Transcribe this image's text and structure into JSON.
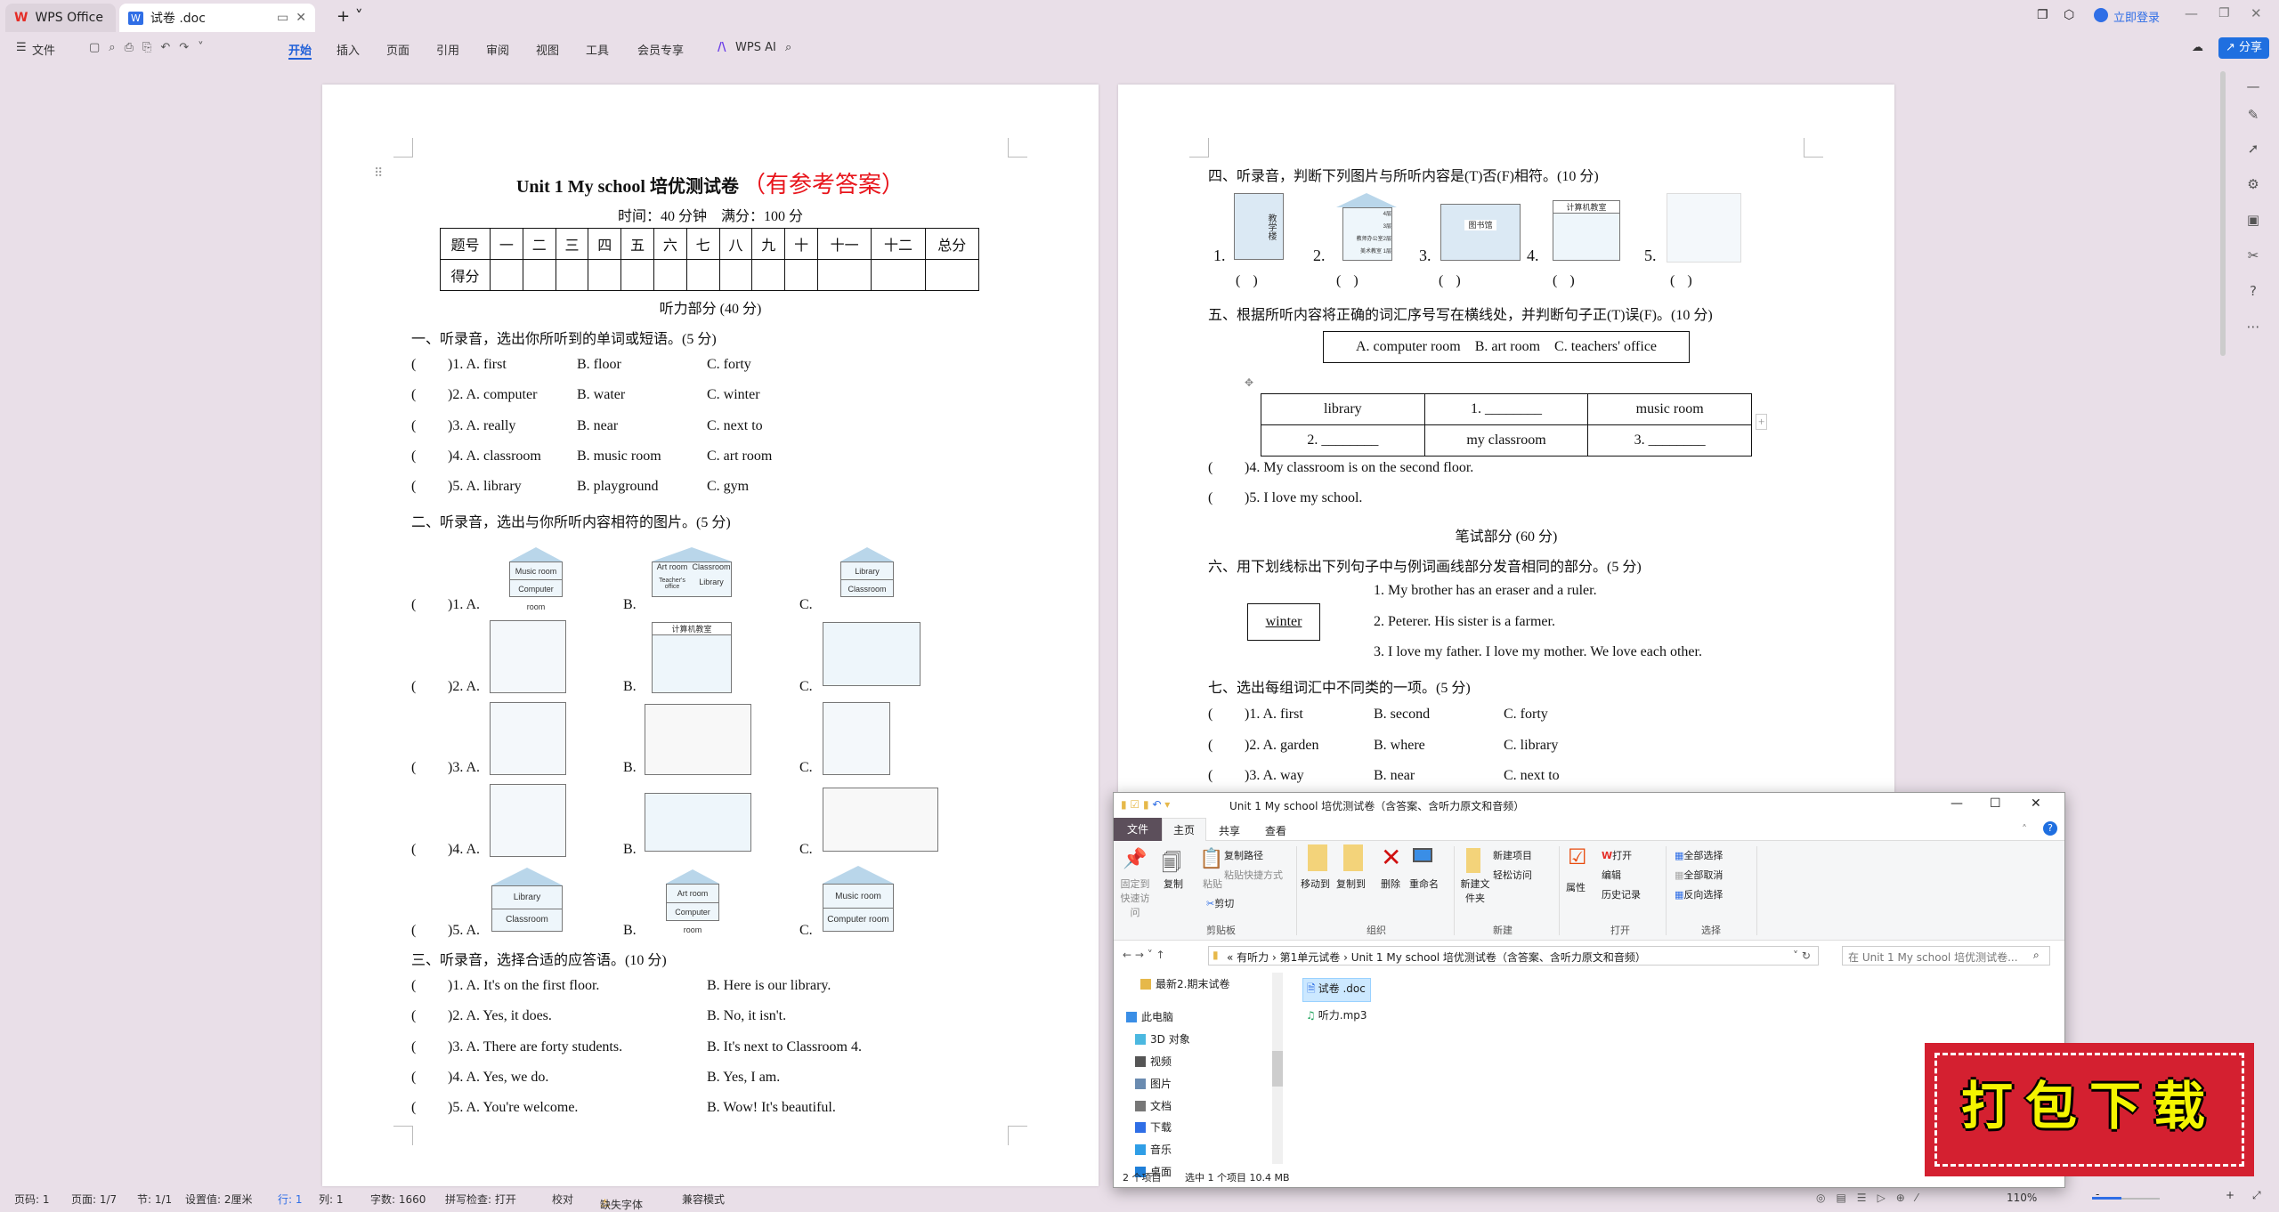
{
  "app": {
    "tabs": [
      {
        "label": "WPS Office",
        "icon": "wps-logo-icon"
      },
      {
        "label": "试卷 .doc",
        "icon": "word-doc-icon"
      }
    ],
    "login": "立即登录",
    "share": "分享",
    "toolbar": {
      "file": "文件",
      "menus": [
        "开始",
        "插入",
        "页面",
        "引用",
        "审阅",
        "视图",
        "工具",
        "会员专享"
      ],
      "active": "开始",
      "ai": "WPS AI"
    }
  },
  "doc_left": {
    "title": "Unit 1 My school 培优测试卷",
    "title_note": "（有参考答案）",
    "title_note_color": "#e8141b",
    "time": "时间：40 分钟　满分：100 分",
    "score_table": {
      "row1": [
        "题号",
        "一",
        "二",
        "三",
        "四",
        "五",
        "六",
        "七",
        "八",
        "九",
        "十",
        "十一",
        "十二",
        "总分"
      ],
      "row2_label": "得分"
    },
    "listening": "听力部分 (40 分)",
    "s1": {
      "heading": "一、听录音，选出你所听到的单词或短语。(5 分)",
      "items": [
        {
          "n": ")1. A. first",
          "b": "B. floor",
          "c": "C. forty"
        },
        {
          "n": ")2. A. computer",
          "b": "B. water",
          "c": "C. winter"
        },
        {
          "n": ")3. A. really",
          "b": "B. near",
          "c": "C. next to"
        },
        {
          "n": ")4. A. classroom",
          "b": "B. music room",
          "c": "C. art room"
        },
        {
          "n": ")5. A. library",
          "b": "B. playground",
          "c": "C. gym"
        }
      ]
    },
    "s2": {
      "heading": "二、听录音，选出与你所听内容相符的图片。(5 分)",
      "items": [
        ")1. A.",
        ")2. A.",
        ")3. A.",
        ")4. A.",
        ")5. A."
      ],
      "b": "B.",
      "c": "C.",
      "img_labels": {
        "r1a": [
          "Music room",
          "Computer room"
        ],
        "r1b": [
          "Art room",
          "Classroom",
          "Teacher's office",
          "Library"
        ],
        "r1c": [
          "Library",
          "Classroom"
        ],
        "r2b": "计算机教室",
        "r5a": [
          "Library",
          "Classroom"
        ],
        "r5b": [
          "Art room",
          "Computer room"
        ],
        "r5c": [
          "Music room",
          "Computer room"
        ]
      }
    },
    "s3": {
      "heading": "三、听录音，选择合适的应答语。(10 分)",
      "items": [
        {
          "a": ")1. A. It's on the first floor.",
          "b": "B. Here is our library."
        },
        {
          "a": ")2. A. Yes, it does.",
          "b": "B. No, it isn't."
        },
        {
          "a": ")3. A. There are forty students.",
          "b": "B. It's next to Classroom 4."
        },
        {
          "a": ")4. A. Yes, we do.",
          "b": "B. Yes, I am."
        },
        {
          "a": ")5. A. You're welcome.",
          "b": "B. Wow!  It's beautiful."
        }
      ]
    },
    "paren": "("
  },
  "doc_right": {
    "s4": {
      "heading": "四、听录音，判断下列图片与所听内容是(T)否(F)相符。(10 分)",
      "nums": [
        "1.",
        "2.",
        "3.",
        "4.",
        "5."
      ],
      "paren": "(        )",
      "img_labels": {
        "p1": "教学楼",
        "p2": [
          "4层",
          "3层",
          "教师办公室2层",
          "美术教室 1层"
        ],
        "p3": "图书馆",
        "p4": "计算机教室"
      }
    },
    "s5": {
      "heading": "五、根据所听内容将正确的词汇序号写在横线处，并判断句子正(T)误(F)。(10 分)",
      "options": "A. computer room　B. art room　C. teachers' office",
      "table": [
        [
          "library",
          "1. ________",
          "music room"
        ],
        [
          "2. ________",
          "my classroom",
          "3. ________"
        ]
      ],
      "items": [
        ")4. My classroom is on the second floor.",
        ")5. I love my school."
      ]
    },
    "written": "笔试部分 (60 分)",
    "s6": {
      "heading": "六、用下划线标出下列句子中与例词画线部分发音相同的部分。(5 分)",
      "example": "winter",
      "items": [
        "1. My brother has an eraser and a ruler.",
        "2. Peterer. His sister is a farmer.",
        "3. I love my father. I love my mother. We love each other."
      ]
    },
    "s7": {
      "heading": "七、选出每组词汇中不同类的一项。(5 分)",
      "items": [
        {
          "a": ")1. A. first",
          "b": "B. second",
          "c": "C. forty"
        },
        {
          "a": ")2. A. garden",
          "b": "B. where",
          "c": "C. library"
        },
        {
          "a": ")3. A. way",
          "b": "B. near",
          "c": "C. next to"
        }
      ]
    }
  },
  "explorer": {
    "title": "Unit 1 My school 培优测试卷（含答案、含听力原文和音频）",
    "tabs": [
      "文件",
      "主页",
      "共享",
      "查看"
    ],
    "active_tab": "主页",
    "ribbon": {
      "clipboard": {
        "label": "剪贴板",
        "pin": "固定到快速访问",
        "copy": "复制",
        "paste": "粘贴",
        "copy_path": "复制路径",
        "paste_shortcut": "粘贴快捷方式",
        "cut": "剪切"
      },
      "organize": {
        "label": "组织",
        "move": "移动到",
        "copyto": "复制到",
        "delete": "删除",
        "rename": "重命名"
      },
      "new": {
        "label": "新建",
        "folder": "新建文件夹",
        "item": "新建项目",
        "easy": "轻松访问"
      },
      "open": {
        "label": "打开",
        "props": "属性",
        "open": "打开",
        "edit": "编辑",
        "history": "历史记录"
      },
      "select": {
        "label": "选择",
        "all": "全部选择",
        "none": "全部取消",
        "invert": "反向选择"
      }
    },
    "path": [
      "有听力",
      "第1单元试卷",
      "Unit 1 My school 培优测试卷（含答案、含听力原文和音频）"
    ],
    "search_placeholder": "在 Unit 1 My school 培优测试卷...",
    "nav": [
      "最新2.期末试卷",
      "此电脑",
      "3D 对象",
      "视频",
      "图片",
      "文档",
      "下载",
      "音乐",
      "桌面"
    ],
    "files": [
      {
        "name": "试卷 .doc",
        "selected": true
      },
      {
        "name": "听力.mp3",
        "selected": false
      }
    ],
    "status_count": "2 个项目",
    "status_sel": "选中 1 个项目  10.4 MB"
  },
  "stamp": {
    "text": "打包下载",
    "bg": "#d42030",
    "fg": "#f4f400"
  },
  "statusbar": {
    "page": "页码: 1",
    "pages": "页面: 1/7",
    "section": "节: 1/1",
    "setting": "设置值: 2厘米",
    "row": "行: 1",
    "col": "列: 1",
    "words": "字数: 1660",
    "spell": "拼写检查: 打开",
    "proof": "校对",
    "font_missing": "缺失字体",
    "compat": "兼容模式",
    "zoom": "110%",
    "zoom_level": 110
  }
}
